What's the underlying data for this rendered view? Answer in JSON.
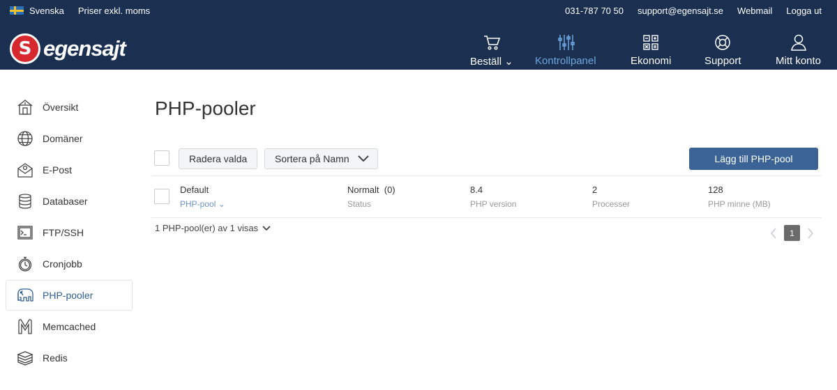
{
  "topbar": {
    "language": "Svenska",
    "price_mode": "Priser exkl. moms",
    "phone": "031-787 70 50",
    "email": "support@egensajt.se",
    "webmail": "Webmail",
    "logout": "Logga ut"
  },
  "brand": {
    "name": "egensajt"
  },
  "nav": {
    "order": "Beställ",
    "control_panel": "Kontrollpanel",
    "economy": "Ekonomi",
    "support": "Support",
    "account": "Mitt konto"
  },
  "sidebar": {
    "items": [
      {
        "label": "Översikt",
        "icon": "house-icon"
      },
      {
        "label": "Domäner",
        "icon": "globe-icon"
      },
      {
        "label": "E-Post",
        "icon": "mail-icon"
      },
      {
        "label": "Databaser",
        "icon": "database-icon"
      },
      {
        "label": "FTP/SSH",
        "icon": "terminal-icon"
      },
      {
        "label": "Cronjobb",
        "icon": "stopwatch-icon"
      },
      {
        "label": "PHP-pooler",
        "icon": "elephant-icon"
      },
      {
        "label": "Memcached",
        "icon": "memcached-icon"
      },
      {
        "label": "Redis",
        "icon": "redis-icon"
      }
    ],
    "active": "PHP-pooler"
  },
  "main": {
    "title": "PHP-pooler",
    "delete_selected": "Radera valda",
    "sort_label": "Sortera på Namn",
    "add_button": "Lägg till PHP-pool",
    "row": {
      "name": "Default",
      "type": "PHP-pool",
      "status_value": "Normalt",
      "status_count": "(0)",
      "status_label": "Status",
      "php_version": "8.4",
      "php_version_label": "PHP version",
      "processes": "2",
      "processes_label": "Processer",
      "memory": "128",
      "memory_label": "PHP minne (MB)"
    },
    "count_text": "1 PHP-pool(er) av 1 visas",
    "current_page": "1"
  },
  "colors": {
    "header_bg": "#1b3050",
    "accent": "#6ea6df",
    "primary_button": "#3b6396",
    "logo_red": "#d7282f"
  }
}
